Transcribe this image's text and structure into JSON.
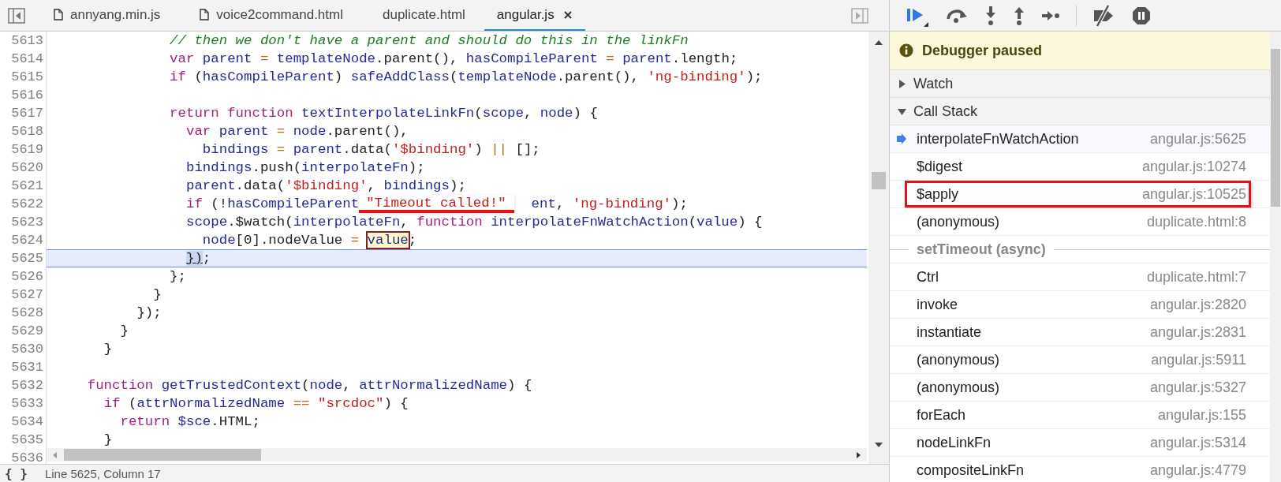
{
  "tabs": [
    {
      "label": "annyang.min.js",
      "has_icon": true,
      "closable": false,
      "selected": false
    },
    {
      "label": "voice2command.html",
      "has_icon": true,
      "closable": false,
      "selected": false
    },
    {
      "label": "duplicate.html",
      "has_icon": false,
      "closable": false,
      "selected": false
    },
    {
      "label": "angular.js",
      "has_icon": false,
      "closable": true,
      "selected": true
    }
  ],
  "editor": {
    "lines": [
      {
        "number": "5613",
        "current": false,
        "tokens": [
          {
            "kind": "comment",
            "text": "              // then we don't have a parent and should do this in the linkFn"
          }
        ]
      },
      {
        "number": "5614",
        "current": false,
        "tokens": [
          {
            "kind": "keyword",
            "text": "              var"
          },
          {
            "kind": "name",
            "text": " parent"
          },
          {
            "kind": "operator",
            "text": " ="
          },
          {
            "kind": "name",
            "text": " templateNode"
          },
          {
            "kind": "plain",
            "text": ".parent(),"
          },
          {
            "kind": "name",
            "text": " hasCompileParent"
          },
          {
            "kind": "operator",
            "text": " ="
          },
          {
            "kind": "name",
            "text": " parent"
          },
          {
            "kind": "plain",
            "text": ".length;"
          }
        ]
      },
      {
        "number": "5615",
        "current": false,
        "tokens": [
          {
            "kind": "keyword",
            "text": "              if"
          },
          {
            "kind": "plain",
            "text": " ("
          },
          {
            "kind": "name",
            "text": "hasCompileParent"
          },
          {
            "kind": "plain",
            "text": ")"
          },
          {
            "kind": "name",
            "text": " safeAddClass"
          },
          {
            "kind": "plain",
            "text": "("
          },
          {
            "kind": "name",
            "text": "templateNode"
          },
          {
            "kind": "plain",
            "text": ".parent(),"
          },
          {
            "kind": "string",
            "text": " 'ng-binding'"
          },
          {
            "kind": "plain",
            "text": ");"
          }
        ]
      },
      {
        "number": "5616",
        "current": false
      },
      {
        "number": "5617",
        "current": false,
        "tokens": [
          {
            "kind": "keyword",
            "text": "              return"
          },
          {
            "kind": "keyword",
            "text": " function"
          },
          {
            "kind": "name",
            "text": " textInterpolateLinkFn"
          },
          {
            "kind": "plain",
            "text": "("
          },
          {
            "kind": "name",
            "text": "scope"
          },
          {
            "kind": "plain",
            "text": ","
          },
          {
            "kind": "name",
            "text": " node"
          },
          {
            "kind": "plain",
            "text": ") {"
          }
        ]
      },
      {
        "number": "5618",
        "current": false,
        "tokens": [
          {
            "kind": "keyword",
            "text": "                var"
          },
          {
            "kind": "name",
            "text": " parent"
          },
          {
            "kind": "operator",
            "text": " ="
          },
          {
            "kind": "name",
            "text": " node"
          },
          {
            "kind": "plain",
            "text": ".parent(),"
          }
        ]
      },
      {
        "number": "5619",
        "current": false,
        "tokens": [
          {
            "kind": "name",
            "text": "                  bindings"
          },
          {
            "kind": "operator",
            "text": " ="
          },
          {
            "kind": "name",
            "text": " parent"
          },
          {
            "kind": "plain",
            "text": ".data("
          },
          {
            "kind": "string",
            "text": "'$binding'"
          },
          {
            "kind": "plain",
            "text": ")"
          },
          {
            "kind": "operator",
            "text": " ||"
          },
          {
            "kind": "plain",
            "text": " [];"
          }
        ]
      },
      {
        "number": "5620",
        "current": false,
        "tokens": [
          {
            "kind": "name",
            "text": "                bindings"
          },
          {
            "kind": "plain",
            "text": ".push("
          },
          {
            "kind": "name",
            "text": "interpolateFn"
          },
          {
            "kind": "plain",
            "text": ");"
          }
        ]
      },
      {
        "number": "5621",
        "current": false,
        "tokens": [
          {
            "kind": "name",
            "text": "                parent"
          },
          {
            "kind": "plain",
            "text": ".data("
          },
          {
            "kind": "string",
            "text": "'$binding'"
          },
          {
            "kind": "plain",
            "text": ","
          },
          {
            "kind": "name",
            "text": " bindings"
          },
          {
            "kind": "plain",
            "text": ");"
          }
        ]
      },
      {
        "number": "5622",
        "current": false,
        "tokens": [
          {
            "kind": "keyword",
            "text": "                if"
          },
          {
            "kind": "plain",
            "text": " (!"
          },
          {
            "kind": "name",
            "text": "hasCompileParent"
          },
          {
            "kind": "tooltip",
            "text": "\"Timeout called!\""
          },
          {
            "kind": "name",
            "text": "ent"
          },
          {
            "kind": "plain",
            "text": ","
          },
          {
            "kind": "string",
            "text": " 'ng-binding'"
          },
          {
            "kind": "plain",
            "text": ");"
          }
        ]
      },
      {
        "number": "5623",
        "current": false,
        "tokens": [
          {
            "kind": "name",
            "text": "                scope"
          },
          {
            "kind": "plain",
            "text": ".$watch("
          },
          {
            "kind": "name",
            "text": "interpolateFn"
          },
          {
            "kind": "plain",
            "text": ","
          },
          {
            "kind": "keyword",
            "text": " function"
          },
          {
            "kind": "name",
            "text": " interpolateFnWatchAction"
          },
          {
            "kind": "plain",
            "text": "("
          },
          {
            "kind": "name",
            "text": "value"
          },
          {
            "kind": "plain",
            "text": ") {"
          }
        ]
      },
      {
        "number": "5624",
        "current": false,
        "tokens": [
          {
            "kind": "name",
            "text": "                  node"
          },
          {
            "kind": "plain",
            "text": "[0].nodeValue"
          },
          {
            "kind": "operator",
            "text": " = "
          },
          {
            "kind": "hover",
            "text": "value"
          },
          {
            "kind": "plain",
            "text": ";"
          }
        ]
      },
      {
        "number": "5625",
        "current": true,
        "tokens": [
          {
            "kind": "match",
            "text": "                })"
          },
          {
            "kind": "plain",
            "text": ";"
          }
        ]
      },
      {
        "number": "5626",
        "current": false,
        "tokens": [
          {
            "kind": "plain",
            "text": "              };"
          }
        ]
      },
      {
        "number": "5627",
        "current": false,
        "tokens": [
          {
            "kind": "plain",
            "text": "            }"
          }
        ]
      },
      {
        "number": "5628",
        "current": false,
        "tokens": [
          {
            "kind": "plain",
            "text": "          });"
          }
        ]
      },
      {
        "number": "5629",
        "current": false,
        "tokens": [
          {
            "kind": "plain",
            "text": "        }"
          }
        ]
      },
      {
        "number": "5630",
        "current": false,
        "tokens": [
          {
            "kind": "plain",
            "text": "      }"
          }
        ]
      },
      {
        "number": "5631",
        "current": false
      },
      {
        "number": "5632",
        "current": false,
        "tokens": [
          {
            "kind": "keyword",
            "text": "    function"
          },
          {
            "kind": "name",
            "text": " getTrustedContext"
          },
          {
            "kind": "plain",
            "text": "("
          },
          {
            "kind": "name",
            "text": "node"
          },
          {
            "kind": "plain",
            "text": ","
          },
          {
            "kind": "name",
            "text": " attrNormalizedName"
          },
          {
            "kind": "plain",
            "text": ") {"
          }
        ]
      },
      {
        "number": "5633",
        "current": false,
        "tokens": [
          {
            "kind": "keyword",
            "text": "      if"
          },
          {
            "kind": "plain",
            "text": " ("
          },
          {
            "kind": "name",
            "text": "attrNormalizedName"
          },
          {
            "kind": "operator",
            "text": " =="
          },
          {
            "kind": "string",
            "text": " \"srcdoc\""
          },
          {
            "kind": "plain",
            "text": ") {"
          }
        ]
      },
      {
        "number": "5634",
        "current": false,
        "tokens": [
          {
            "kind": "keyword",
            "text": "        return"
          },
          {
            "kind": "name",
            "text": " $sce"
          },
          {
            "kind": "plain",
            "text": ".HTML;"
          }
        ]
      },
      {
        "number": "5635",
        "current": false,
        "tokens": [
          {
            "kind": "plain",
            "text": "      }"
          }
        ]
      },
      {
        "number": "5636",
        "current": false
      }
    ]
  },
  "status_bar": {
    "format_button": "{ }",
    "position": "Line 5625, Column 17"
  },
  "debugger": {
    "banner": "Debugger paused",
    "sections": [
      {
        "title": "Watch",
        "expanded": false
      },
      {
        "title": "Call Stack",
        "expanded": true
      }
    ],
    "call_stack": [
      {
        "kind": "frame",
        "name": "interpolateFnWatchAction",
        "location": "angular.js:5625",
        "current": true,
        "annotated": false
      },
      {
        "kind": "frame",
        "name": "$digest",
        "location": "angular.js:10274",
        "current": false,
        "annotated": false
      },
      {
        "kind": "frame",
        "name": "$apply",
        "location": "angular.js:10525",
        "current": false,
        "annotated": true
      },
      {
        "kind": "frame",
        "name": "(anonymous)",
        "location": "duplicate.html:8",
        "current": false,
        "annotated": false
      },
      {
        "kind": "async",
        "label": "setTimeout (async)"
      },
      {
        "kind": "frame",
        "name": "Ctrl",
        "location": "duplicate.html:7",
        "current": false,
        "annotated": false
      },
      {
        "kind": "frame",
        "name": "invoke",
        "location": "angular.js:2820",
        "current": false,
        "annotated": false
      },
      {
        "kind": "frame",
        "name": "instantiate",
        "location": "angular.js:2831",
        "current": false,
        "annotated": false
      },
      {
        "kind": "frame",
        "name": "(anonymous)",
        "location": "angular.js:5911",
        "current": false,
        "annotated": false
      },
      {
        "kind": "frame",
        "name": "(anonymous)",
        "location": "angular.js:5327",
        "current": false,
        "annotated": false
      },
      {
        "kind": "frame",
        "name": "forEach",
        "location": "angular.js:155",
        "current": false,
        "annotated": false
      },
      {
        "kind": "frame",
        "name": "nodeLinkFn",
        "location": "angular.js:5314",
        "current": false,
        "annotated": false
      },
      {
        "kind": "frame",
        "name": "compositeLinkFn",
        "location": "angular.js:4779",
        "current": false,
        "annotated": false
      }
    ]
  }
}
